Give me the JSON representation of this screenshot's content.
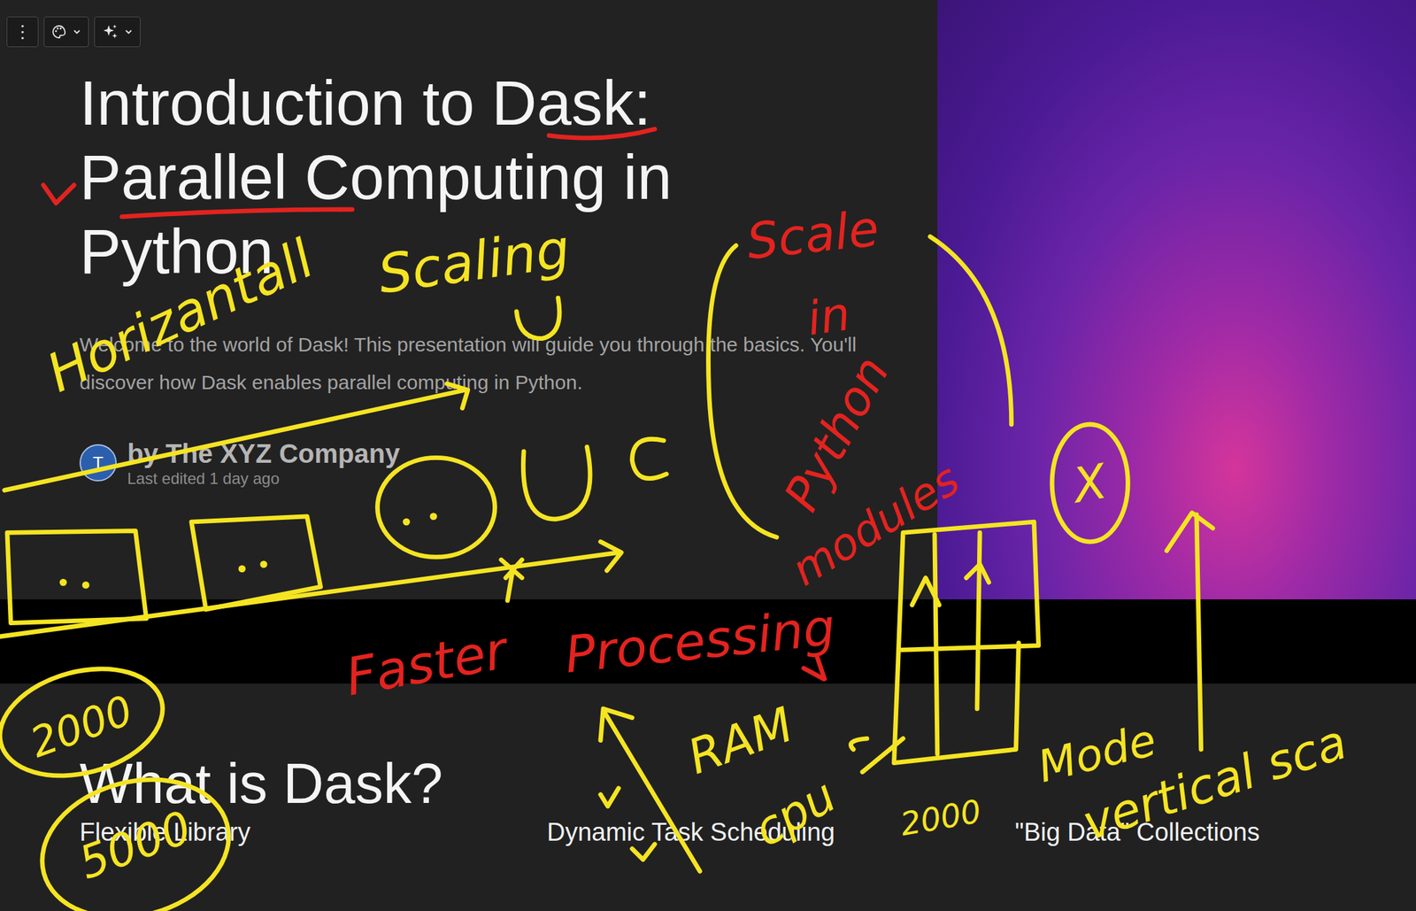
{
  "toolbar": {
    "menu": "⋮"
  },
  "slide": {
    "title": "Introduction to Dask: Parallel Computing in Python",
    "subtitle": "Welcome to the world of Dask! This presentation will guide you through the basics. You'll discover how Dask enables parallel computing in Python.",
    "author": {
      "avatar": "T",
      "name": "by The XYZ Company",
      "edited": "Last edited 1 day ago"
    }
  },
  "next_slide": {
    "title": "What is Dask?",
    "columns": [
      "Flexible Library",
      "Dynamic Task Scheduling",
      "\"Big Data\" Collections"
    ]
  },
  "annotations": [
    {
      "text": "Horizantall",
      "color": "#f5e422"
    },
    {
      "text": "Scaling",
      "color": "#f5e422"
    },
    {
      "text": "Scale",
      "color": "#e3231f"
    },
    {
      "text": "in",
      "color": "#e3231f"
    },
    {
      "text": "Python",
      "color": "#e3231f"
    },
    {
      "text": "modules",
      "color": "#e3231f"
    },
    {
      "text": "Faster",
      "color": "#e3231f"
    },
    {
      "text": "Processing",
      "color": "#e3231f"
    },
    {
      "text": "RAM",
      "color": "#f5e422"
    },
    {
      "text": "cpu",
      "color": "#f5e422"
    },
    {
      "text": "2000",
      "color": "#f5e422"
    },
    {
      "text": "Mode",
      "color": "#f5e422"
    },
    {
      "text": "vertical sca",
      "color": "#f5e422"
    },
    {
      "text": "2000",
      "color": "#f5e422"
    },
    {
      "text": "5000",
      "color": "#f5e422"
    },
    {
      "text": "X",
      "color": "#f5e422"
    }
  ]
}
